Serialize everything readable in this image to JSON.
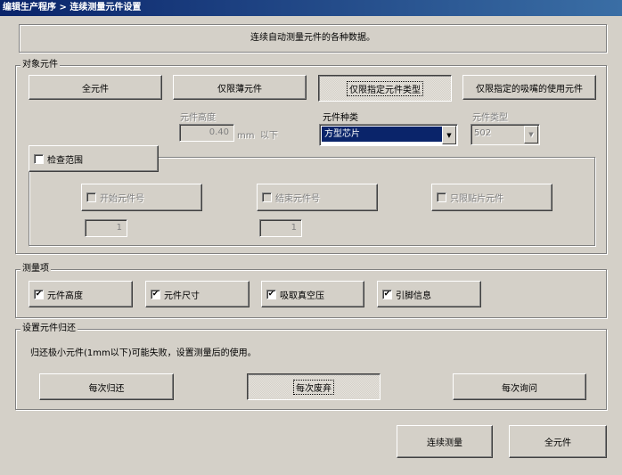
{
  "title": "编辑生产程序 > 连续测量元件设置",
  "description": "连续自动测量元件的各种数据。",
  "target": {
    "legend": "对象元件",
    "buttons": [
      "全元件",
      "仅限薄元件",
      "仅限指定元件类型",
      "仅限指定的吸嘴的使用元件"
    ],
    "height_label": "元件高度",
    "height_value": "0.40",
    "height_unit": "mm",
    "height_suffix": "以下",
    "kind_label": "元件种类",
    "kind_value": "方型芯片",
    "type_label": "元件类型",
    "type_value": "502",
    "range_check_label": "检查范围",
    "start_label": "开始元件号",
    "start_value": "1",
    "end_label": "结束元件号",
    "end_value": "1",
    "mount_only_label": "只限贴片元件"
  },
  "measure": {
    "legend": "测量项",
    "items": [
      {
        "label": "元件高度",
        "checked": "✔"
      },
      {
        "label": "元件尺寸",
        "checked": "✔"
      },
      {
        "label": "吸取真空压",
        "checked": "✔"
      },
      {
        "label": "引脚信息",
        "checked": "✔"
      }
    ]
  },
  "return": {
    "legend": "设置元件归还",
    "note": "归还极小元件(1mm以下)可能失败，设置测量后的使用。",
    "buttons": [
      "每次归还",
      "每次废弃",
      "每次询问"
    ]
  },
  "footer": {
    "continuous": "连续测量",
    "all": "全元件"
  },
  "icons": {
    "dropdown": "▼"
  }
}
